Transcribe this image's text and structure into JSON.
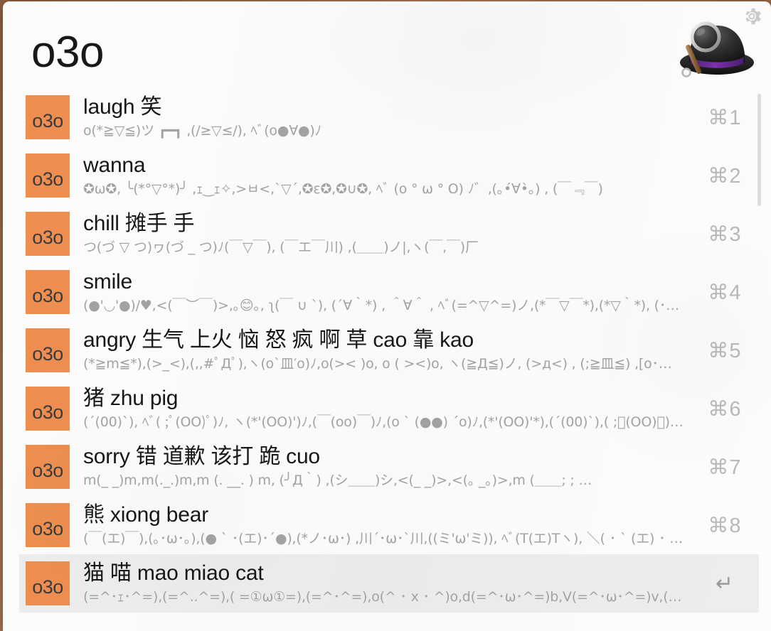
{
  "app": {
    "name": "Alfred",
    "logo_icon": "alfred-hat-icon",
    "gear_icon": "gear-icon"
  },
  "search": {
    "value": "o3o",
    "placeholder": "",
    "icon": "search-icon"
  },
  "results": {
    "icon_label": "o3o",
    "scrollbar": {
      "visible": true
    },
    "items": [
      {
        "title": "laugh 笑",
        "subtitle": "o(*≧▽≦)ツ ┏━┓ ,(/≥▽≤/), ﾍﾞ(o●∀●)ﾉ",
        "shortcut": "⌘1",
        "selected": false
      },
      {
        "title": "wanna",
        "subtitle": "✪ω✪, ╰(*°▽°*)╯ ,ｪ‿ｪ✧,>ㅂ<,`▽´,✪ε✪,✪∪✪, ﾍﾞ (o ° ω ° O) ﾉ゛,(｡•́∀•̀｡) , (￣﹃￣)",
        "shortcut": "⌘2",
        "selected": false
      },
      {
        "title": "chill 摊手 手",
        "subtitle": "つ(づ ▽ つ)ヮ(づ _ つ)ﾉ(￣▽￣), (￣エ￣川) ,(＿＿)ノ|,ヽ(￣,￣)厂",
        "shortcut": "⌘3",
        "selected": false
      },
      {
        "title": "smile",
        "subtitle": "(●'◡'●)/♥,<(￣︶￣)>,｡😊｡, ʅ(￣ ∪ ˋ), (´∀｀*) , ＾∀＾ , ﾍﾞ(=^▽^=)ノ,(*￣▽￣*),(*▽｀*), (･ω･…",
        "shortcut": "⌘4",
        "selected": false
      },
      {
        "title": "angry 生气 上火 恼 怒 疯 啊 草 cao 靠 kao",
        "subtitle": "(*≧m≦*),(>_<),(,,#ﾟДﾟ),ヽ(o`皿′o)ﾉ,o(>< )o, o ( ><)o, ヽ(≧Д≦)ノ, (>д<) , (;≧皿≦) ,[o･…",
        "shortcut": "⌘5",
        "selected": false
      },
      {
        "title": "猪 zhu pig",
        "subtitle": "(´(00)`), ﾍﾞ( ;ﾟ(OO)ﾟ)ﾉ, ヽ(*'(OO)')ﾉ,(￣(oo)￣)ﾉ,(o ` (●●) ´o)ﾉ,(*'(OO)'*),(´(00)`),( ;ﾟ(OO)ﾟ),(…",
        "shortcut": "⌘6",
        "selected": false
      },
      {
        "title": "sorry 错 道歉 该打 跪 cuo",
        "subtitle": "m(_ _)m,m(._.)m,m (. __. ) m, (╯Д｀) ,(シ＿＿)シ,<(_ _)>,<(｡ _｡)>,m (＿＿; ; …",
        "shortcut": "⌘7",
        "selected": false
      },
      {
        "title": "熊 xiong bear",
        "subtitle": "(￣(エ)￣),(｡･ω･｡),(● ` ･(エ)･´●),(*ノ･ω･) ,川´･ω･`川,((ミ'ω'ミ)), ﾍﾞ(T(エ)Tヽ), ＼( ･ ` (エ) ･ )/,…",
        "shortcut": "⌘8",
        "selected": false
      },
      {
        "title": "猫 喵 mao miao cat",
        "subtitle": "(=^･ｪ･^=),(=^..^=),( =①ω①=),(=^･^=),o(^ ･ x ･ ^)o,d(=^･ω･^=)b,V(=^･ω･^=)v,(= T ｪ …",
        "shortcut": "↵",
        "selected": true
      }
    ]
  },
  "colors": {
    "accent_orange": "#ee8e50",
    "window_background": "#fdfcfa",
    "selected_row": "#ededed",
    "title_text": "#161719",
    "subtitle_text": "#a3a3a6",
    "shortcut_text": "#b9b9bb",
    "hat_black": "#262626",
    "hat_band_purple": "#6b2d91",
    "desktop_background": "#8d5f41"
  }
}
